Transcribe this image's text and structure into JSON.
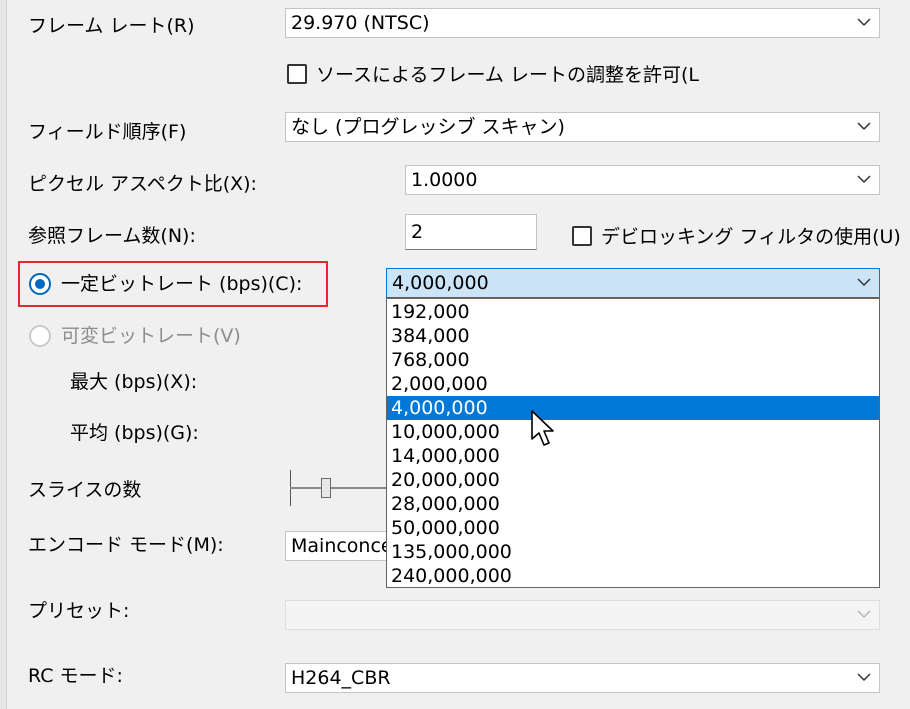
{
  "frame_rate": {
    "label": "フレーム レート(R)",
    "value": "29.970 (NTSC)"
  },
  "allow_source_adjust": {
    "label": "ソースによるフレーム レートの調整を許可(L",
    "checked": false
  },
  "field_order": {
    "label": "フィールド順序(F)",
    "value": "なし (プログレッシブ スキャン)"
  },
  "pixel_aspect": {
    "label": "ピクセル アスペクト比(X):",
    "value": "1.0000"
  },
  "ref_frames": {
    "label": "参照フレーム数(N):",
    "value": "2"
  },
  "deblocking": {
    "label": "デビロッキング フィルタの使用(U)",
    "checked": false
  },
  "constant_bitrate": {
    "label": "一定ビットレート (bps)(C):",
    "value": "4,000,000",
    "selected": true
  },
  "variable_bitrate": {
    "label": "可変ビットレート(V)",
    "selected": false
  },
  "max_bps": {
    "label": "最大 (bps)(X):"
  },
  "avg_bps": {
    "label": "平均 (bps)(G):"
  },
  "slices": {
    "label": "スライスの数"
  },
  "encode_mode": {
    "label": "エンコード モード(M):",
    "value": "Mainconce"
  },
  "preset": {
    "label": "プリセット:",
    "value": ""
  },
  "rc_mode": {
    "label": "RC モード:",
    "value": "H264_CBR"
  },
  "bitrate_options": [
    "192,000",
    "384,000",
    "768,000",
    "2,000,000",
    "4,000,000",
    "10,000,000",
    "14,000,000",
    "20,000,000",
    "28,000,000",
    "50,000,000",
    "135,000,000",
    "240,000,000"
  ],
  "bitrate_selected_index": 4,
  "icons": {
    "dropdown_arrow": "chevron-down-icon",
    "cursor": "mouse-pointer-icon"
  }
}
